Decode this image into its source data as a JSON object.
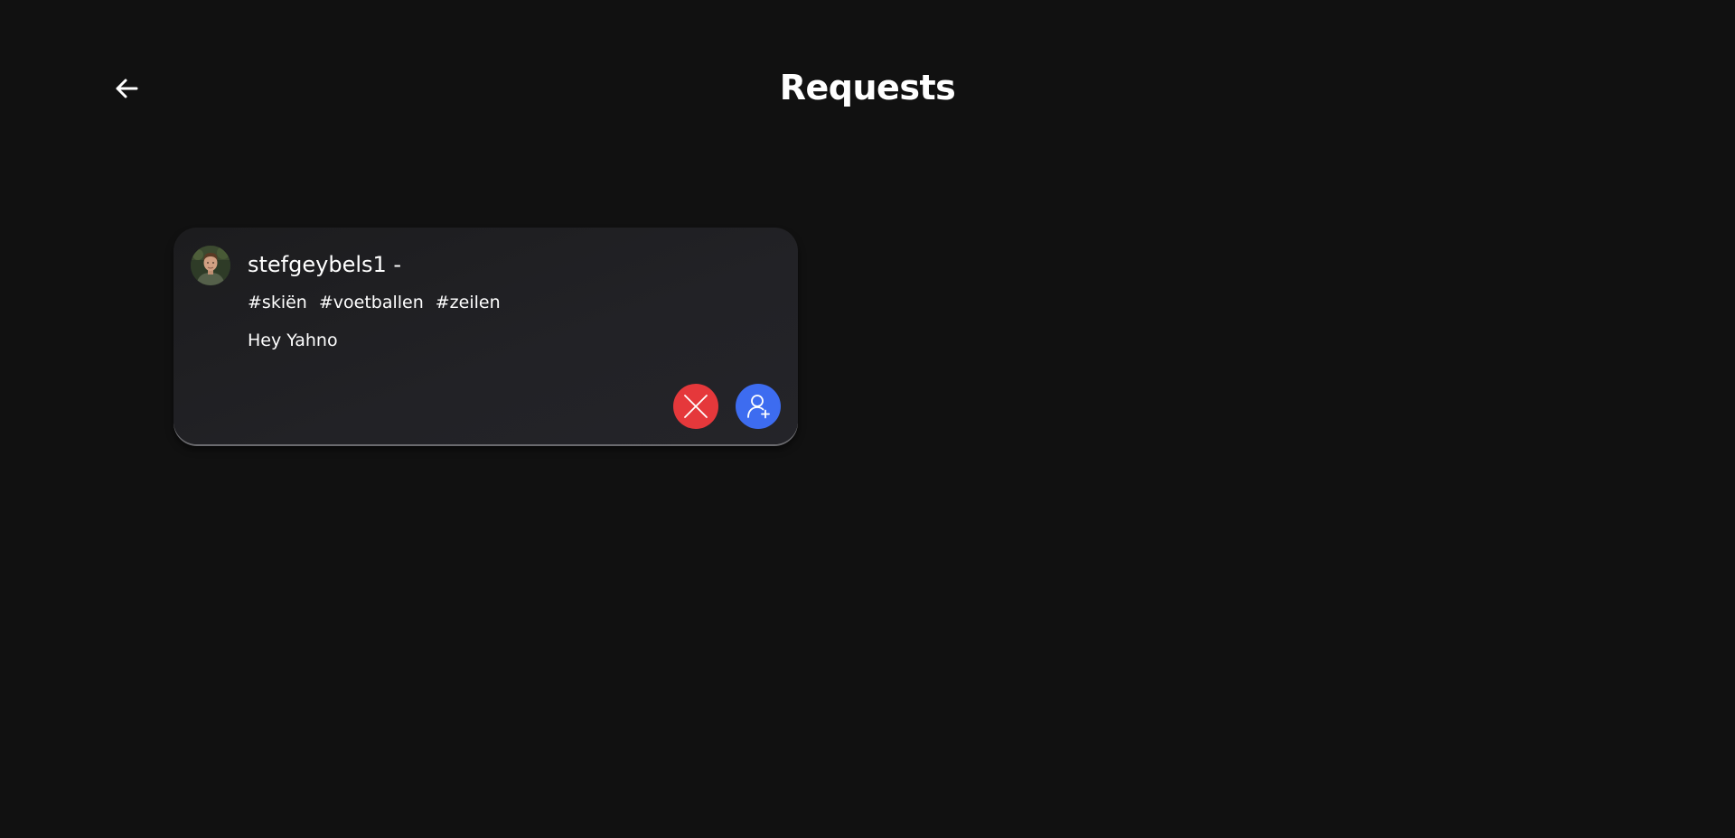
{
  "header": {
    "back_icon": "arrow-left-icon",
    "title": "Requests"
  },
  "requests": [
    {
      "username": "stefgeybels1 -",
      "avatar_icon": "profile-photo",
      "tags": [
        "#skiën",
        "#voetballen",
        "#zeilen"
      ],
      "message": "Hey Yahno",
      "decline_icon": "close-icon",
      "accept_icon": "add-user-icon"
    }
  ],
  "colors": {
    "background": "#111111",
    "card": "#212124",
    "decline": "#e5383b",
    "accept": "#3d6cf0",
    "text": "#ffffff"
  }
}
